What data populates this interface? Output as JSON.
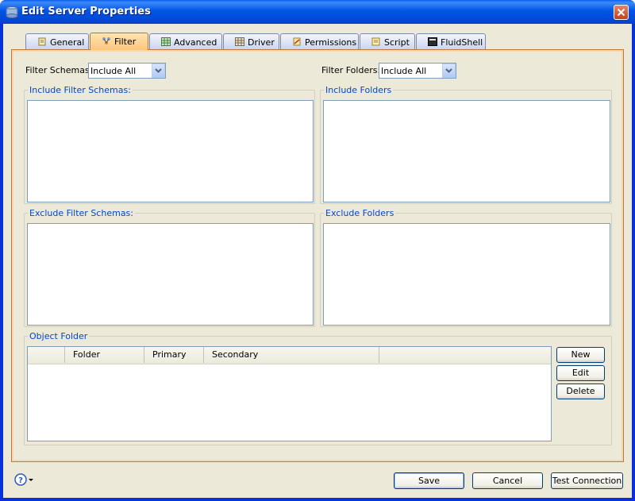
{
  "window": {
    "title": "Edit Server Properties"
  },
  "tabs": [
    {
      "label": "General",
      "icon": "general-icon"
    },
    {
      "label": "Filter",
      "icon": "filter-icon",
      "selected": true
    },
    {
      "label": "Advanced",
      "icon": "advanced-grid-icon"
    },
    {
      "label": "Driver",
      "icon": "driver-grid-icon"
    },
    {
      "label": "Permissions",
      "icon": "permissions-icon"
    },
    {
      "label": "Script",
      "icon": "script-icon"
    },
    {
      "label": "FluidShell",
      "icon": "fluidshell-icon"
    }
  ],
  "filter": {
    "schemas_label": "Filter Schemas:",
    "schemas_value": "Include All",
    "folders_label": "Filter Folders:",
    "folders_value": "Include All"
  },
  "groups": {
    "include_schemas": "Include Filter Schemas:",
    "include_folders": "Include Folders",
    "exclude_schemas": "Exclude Filter Schemas:",
    "exclude_folders": "Exclude Folders",
    "object_folder": "Object Folder"
  },
  "object_table": {
    "columns": [
      "Folder",
      "Primary",
      "Secondary"
    ],
    "rows": []
  },
  "object_buttons": {
    "new": "New",
    "edit": "Edit",
    "delete": "Delete"
  },
  "footer": {
    "save": "Save",
    "cancel": "Cancel",
    "test": "Test Connection"
  },
  "colors": {
    "titlebar": "#0055e5",
    "selected_tab": "#fdc67e",
    "group_title": "#0046d5",
    "panel_border": "#c2783a"
  }
}
